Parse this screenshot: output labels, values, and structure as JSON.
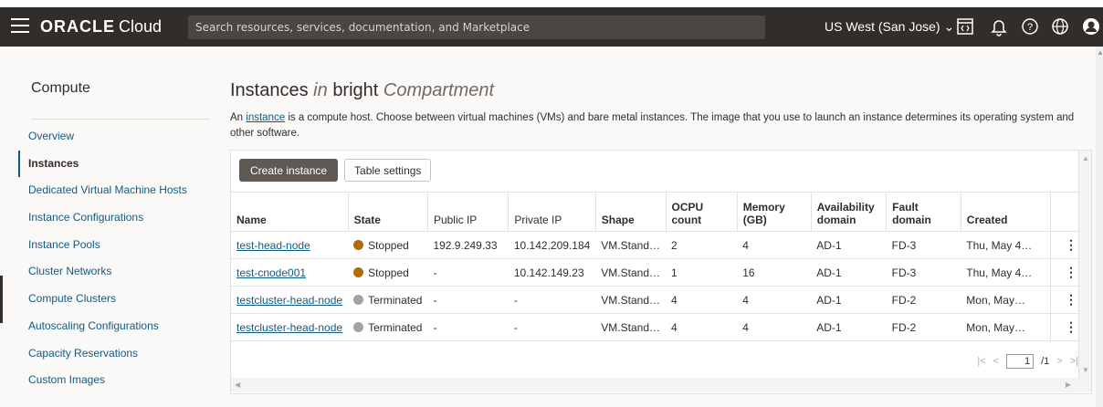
{
  "topbar": {
    "brand_oracle": "ORACLE",
    "brand_cloud": "Cloud",
    "search_placeholder": "Search resources, services, documentation, and Marketplace",
    "region": "US West (San Jose)",
    "icons": [
      "menu-icon",
      "cloud-shell-icon",
      "bell-icon",
      "help-icon",
      "globe-icon",
      "profile-icon"
    ]
  },
  "sidebar": {
    "title": "Compute",
    "items": [
      {
        "label": "Overview"
      },
      {
        "label": "Instances"
      },
      {
        "label": "Dedicated Virtual Machine Hosts"
      },
      {
        "label": "Instance Configurations"
      },
      {
        "label": "Instance Pools"
      },
      {
        "label": "Cluster Networks"
      },
      {
        "label": "Compute Clusters"
      },
      {
        "label": "Autoscaling Configurations"
      },
      {
        "label": "Capacity Reservations"
      },
      {
        "label": "Custom Images"
      }
    ],
    "active_index": 1
  },
  "main": {
    "title_part1": "Instances",
    "title_in": "in",
    "title_part2": "bright",
    "title_part3": "Compartment",
    "desc_prefix": "An",
    "desc_link": "instance",
    "desc_rest": "is a compute host. Choose between virtual machines (VMs) and bare metal instances. The image that you use to launch an instance determines its operating system and other software.",
    "create_button": "Create instance",
    "table_settings_button": "Table settings"
  },
  "table": {
    "headers": {
      "name": "Name",
      "state": "State",
      "public_ip": "Public IP",
      "private_ip": "Private IP",
      "shape": "Shape",
      "ocpu_l1": "OCPU",
      "ocpu_l2": "count",
      "mem_l1": "Memory",
      "mem_l2": "(GB)",
      "ad_l1": "Availability",
      "ad_l2": "domain",
      "fd_l1": "Fault",
      "fd_l2": "domain",
      "created": "Created"
    },
    "rows": [
      {
        "name": "test-head-node",
        "state": "Stopped",
        "public_ip": "192.9.249.33",
        "private_ip": "10.142.209.184",
        "shape": "VM.Stand…",
        "ocpu": "2",
        "memory": "4",
        "ad": "AD-1",
        "fd": "FD-3",
        "created": "Thu, May 4…"
      },
      {
        "name": "test-cnode001",
        "state": "Stopped",
        "public_ip": "-",
        "private_ip": "10.142.149.23",
        "shape": "VM.Stand…",
        "ocpu": "1",
        "memory": "16",
        "ad": "AD-1",
        "fd": "FD-3",
        "created": "Thu, May 4…"
      },
      {
        "name": "testcluster-head-node",
        "state": "Terminated",
        "public_ip": "-",
        "private_ip": "-",
        "shape": "VM.Stand…",
        "ocpu": "4",
        "memory": "4",
        "ad": "AD-1",
        "fd": "FD-2",
        "created": "Mon, May…"
      },
      {
        "name": "testcluster-head-node",
        "state": "Terminated",
        "public_ip": "-",
        "private_ip": "-",
        "shape": "VM.Stand…",
        "ocpu": "4",
        "memory": "4",
        "ad": "AD-1",
        "fd": "FD-2",
        "created": "Mon, May…"
      }
    ],
    "state_colors": {
      "Stopped": "#b56b00",
      "Terminated": "#a7a29d"
    },
    "pager": {
      "current": "1",
      "total": "/1"
    }
  }
}
